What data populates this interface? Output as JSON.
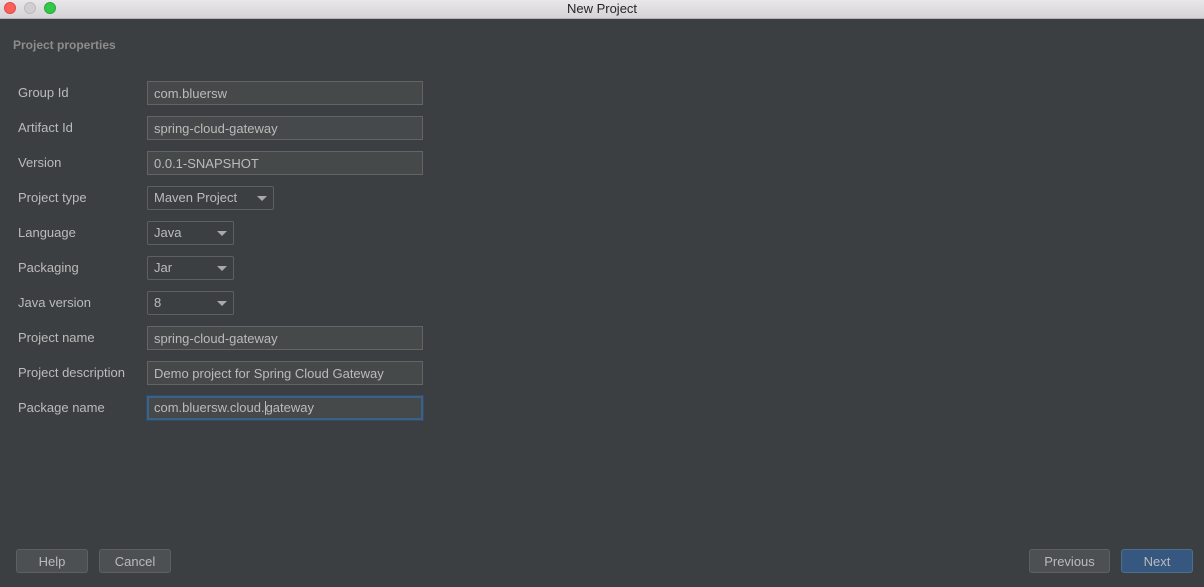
{
  "window": {
    "title": "New Project",
    "section_title": "Project properties"
  },
  "form": {
    "group_id": {
      "label": "Group Id",
      "value": "com.bluersw"
    },
    "artifact_id": {
      "label": "Artifact Id",
      "value": "spring-cloud-gateway"
    },
    "version": {
      "label": "Version",
      "value": "0.0.1-SNAPSHOT"
    },
    "project_type": {
      "label": "Project type",
      "value": "Maven Project"
    },
    "language": {
      "label": "Language",
      "value": "Java"
    },
    "packaging": {
      "label": "Packaging",
      "value": "Jar"
    },
    "java_version": {
      "label": "Java version",
      "value": "8"
    },
    "project_name": {
      "label": "Project name",
      "value": "spring-cloud-gateway"
    },
    "project_description": {
      "label": "Project description",
      "value": "Demo project for Spring Cloud Gateway"
    },
    "package_name": {
      "label": "Package name",
      "value_before_caret": "com.bluersw.cloud.",
      "value_after_caret": "gateway"
    }
  },
  "buttons": {
    "help": "Help",
    "cancel": "Cancel",
    "previous": "Previous",
    "next": "Next"
  },
  "colors": {
    "background": "#3c3f41",
    "field_background": "#45494a",
    "focus_border": "#3d6185",
    "primary_button": "#365880",
    "text": "#bbbbbb"
  }
}
